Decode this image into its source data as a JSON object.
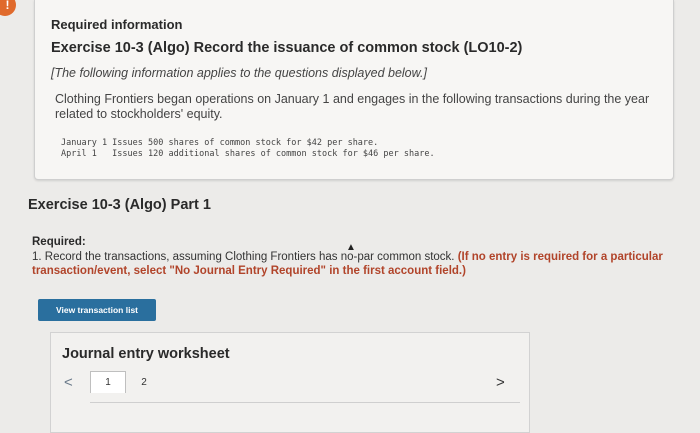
{
  "header": {
    "alert_glyph": "!",
    "required_info": "Required information",
    "exercise_title": "Exercise 10-3 (Algo) Record the issuance of common stock (LO10-2)",
    "note": "[The following information applies to the questions displayed below.]",
    "description": "Clothing Frontiers began operations on January 1 and engages in the following transactions during the year related to stockholders' equity.",
    "transactions": [
      "January 1 Issues 500 shares of common stock for $42 per share.",
      "April 1   Issues 120 additional shares of common stock for $46 per share."
    ]
  },
  "part": {
    "title": "Exercise 10-3 (Algo) Part 1",
    "required_label": "Required:",
    "instruction_text": "1. Record the transactions, assuming Clothing Frontiers has no-par common stock.",
    "instruction_bold": "(If no entry is required for a particular transaction/event, select \"No Journal Entry Required\" in the first account field.)"
  },
  "buttons": {
    "view_transaction_list": "View transaction list"
  },
  "worksheet": {
    "title": "Journal entry worksheet",
    "prev": "<",
    "next": ">",
    "pages": [
      "1",
      "2"
    ],
    "current_page": "1"
  },
  "colors": {
    "button_bg": "#2a6f9e",
    "alert": "#e06a2c",
    "emphasis": "#b1442a"
  },
  "icons": {
    "cursor": "pointer-cursor-icon",
    "alert": "alert-icon"
  }
}
